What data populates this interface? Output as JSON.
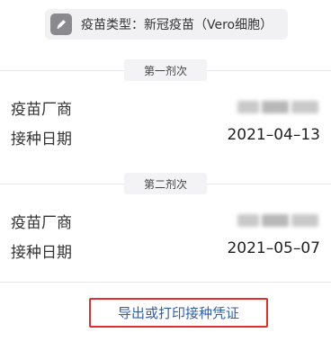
{
  "vaccine_type": {
    "text": "疫苗类型：新冠疫苗（Vero细胞）"
  },
  "doses": [
    {
      "title": "第一剂次",
      "manufacturer_label": "疫苗厂商",
      "date_label": "接种日期",
      "date_value": "2021–04–13"
    },
    {
      "title": "第二剂次",
      "manufacturer_label": "疫苗厂商",
      "date_label": "接种日期",
      "date_value": "2021–05–07"
    }
  ],
  "export_button": {
    "label": "导出或打印接种凭证"
  },
  "icons": {
    "vaccine_chip_icon": "pencil-icon"
  },
  "colors": {
    "highlight_border": "#e02f2f",
    "link_text": "#2f5fb3"
  }
}
